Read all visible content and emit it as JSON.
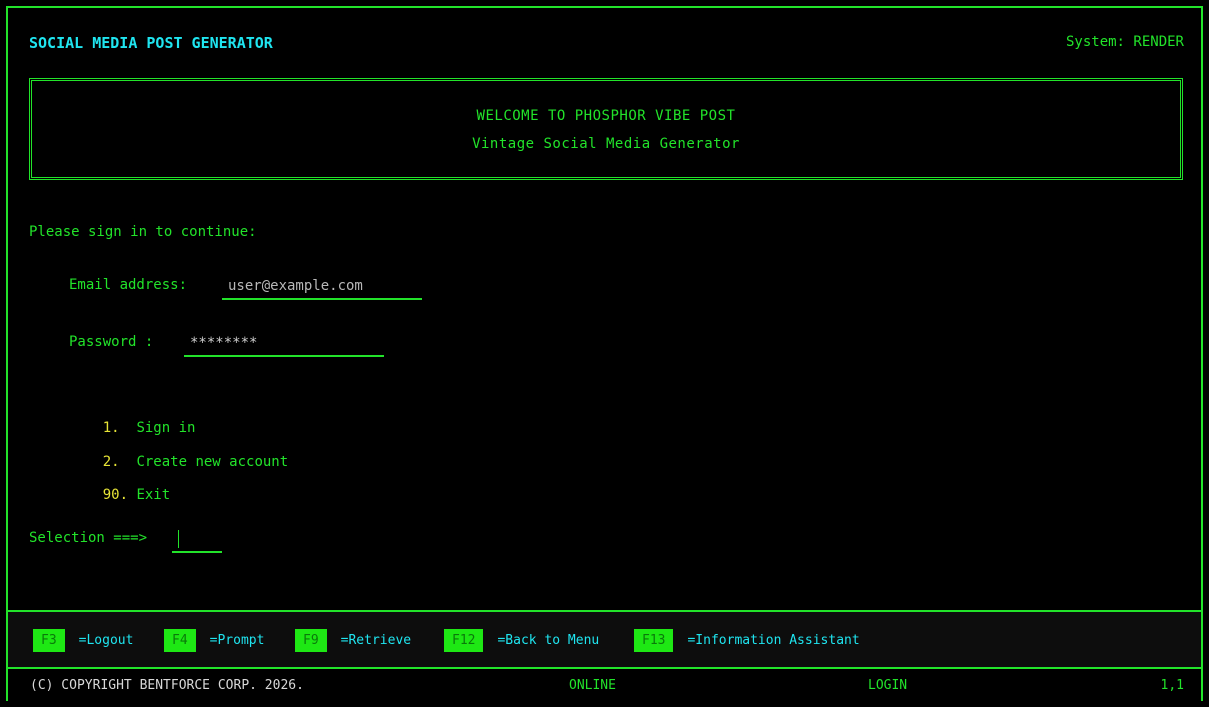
{
  "header": {
    "app_title": "SOCIAL MEDIA POST GENERATOR",
    "system_label": "System: RENDER"
  },
  "welcome": {
    "line1": "WELCOME TO PHOSPHOR VIBE POST",
    "line2": "Vintage Social Media Generator"
  },
  "login": {
    "prompt": "Please sign in to continue:",
    "email_label": "Email address:",
    "email_value": "user@example.com",
    "password_label": "Password :",
    "password_value": "********"
  },
  "menu": {
    "items": [
      {
        "num": "1.",
        "label": "Sign in"
      },
      {
        "num": "2.",
        "label": "Create new account"
      },
      {
        "num": "90.",
        "label": "Exit"
      }
    ]
  },
  "selection": {
    "label": "Selection ===>",
    "value": ""
  },
  "fkeys": [
    {
      "key": "F3",
      "desc": "=Logout"
    },
    {
      "key": "F4",
      "desc": "=Prompt"
    },
    {
      "key": "F9",
      "desc": "=Retrieve"
    },
    {
      "key": "F12",
      "desc": "=Back to Menu"
    },
    {
      "key": "F13",
      "desc": "=Information Assistant"
    }
  ],
  "status": {
    "copyright": "(C) COPYRIGHT BENTFORCE CORP. 2026.",
    "connection": "ONLINE",
    "mode": "LOGIN",
    "cursor_position": "1,1"
  },
  "colors": {
    "foreground": "#22e32a",
    "title_cyan": "#1fe5f0",
    "menu_number_yellow": "#e6e436",
    "fkey_badge": "#1ee814",
    "background": "#000000"
  }
}
